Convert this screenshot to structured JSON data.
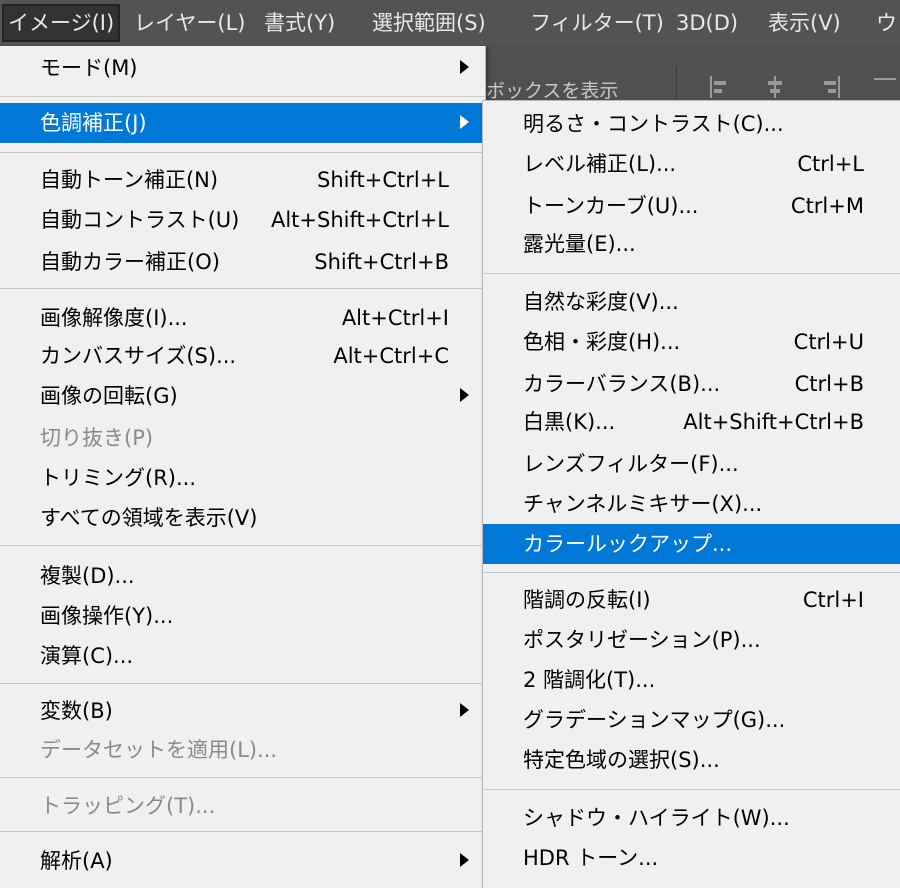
{
  "menubar": {
    "items": [
      {
        "label": "イメージ(I)"
      },
      {
        "label": "レイヤー(L)"
      },
      {
        "label": "書式(Y)"
      },
      {
        "label": "選択範囲(S)"
      },
      {
        "label": "フィルター(T)"
      },
      {
        "label": "3D(D)"
      },
      {
        "label": "表示(V)"
      },
      {
        "label": "ウ"
      }
    ]
  },
  "options_bar": {
    "text": "ボックスを表示"
  },
  "main_menu": {
    "items": [
      {
        "label": "モード(M)",
        "shortcut": ""
      },
      {
        "label": "色調補正(J)",
        "shortcut": ""
      },
      {
        "label": "自動トーン補正(N)",
        "shortcut": "Shift+Ctrl+L"
      },
      {
        "label": "自動コントラスト(U)",
        "shortcut": "Alt+Shift+Ctrl+L"
      },
      {
        "label": "自動カラー補正(O)",
        "shortcut": "Shift+Ctrl+B"
      },
      {
        "label": "画像解像度(I)...",
        "shortcut": "Alt+Ctrl+I"
      },
      {
        "label": "カンバスサイズ(S)...",
        "shortcut": "Alt+Ctrl+C"
      },
      {
        "label": "画像の回転(G)",
        "shortcut": ""
      },
      {
        "label": "切り抜き(P)",
        "shortcut": ""
      },
      {
        "label": "トリミング(R)...",
        "shortcut": ""
      },
      {
        "label": "すべての領域を表示(V)",
        "shortcut": ""
      },
      {
        "label": "複製(D)...",
        "shortcut": ""
      },
      {
        "label": "画像操作(Y)...",
        "shortcut": ""
      },
      {
        "label": "演算(C)...",
        "shortcut": ""
      },
      {
        "label": "変数(B)",
        "shortcut": ""
      },
      {
        "label": "データセットを適用(L)...",
        "shortcut": ""
      },
      {
        "label": "トラッピング(T)...",
        "shortcut": ""
      },
      {
        "label": "解析(A)",
        "shortcut": ""
      }
    ]
  },
  "sub_menu": {
    "items": [
      {
        "label": "明るさ・コントラスト(C)...",
        "shortcut": ""
      },
      {
        "label": "レベル補正(L)...",
        "shortcut": "Ctrl+L"
      },
      {
        "label": "トーンカーブ(U)...",
        "shortcut": "Ctrl+M"
      },
      {
        "label": "露光量(E)...",
        "shortcut": ""
      },
      {
        "label": "自然な彩度(V)...",
        "shortcut": ""
      },
      {
        "label": "色相・彩度(H)...",
        "shortcut": "Ctrl+U"
      },
      {
        "label": "カラーバランス(B)...",
        "shortcut": "Ctrl+B"
      },
      {
        "label": "白黒(K)...",
        "shortcut": "Alt+Shift+Ctrl+B"
      },
      {
        "label": "レンズフィルター(F)...",
        "shortcut": ""
      },
      {
        "label": "チャンネルミキサー(X)...",
        "shortcut": ""
      },
      {
        "label": "カラールックアップ...",
        "shortcut": ""
      },
      {
        "label": "階調の反転(I)",
        "shortcut": "Ctrl+I"
      },
      {
        "label": "ポスタリゼーション(P)...",
        "shortcut": ""
      },
      {
        "label": "2 階調化(T)...",
        "shortcut": ""
      },
      {
        "label": "グラデーションマップ(G)...",
        "shortcut": ""
      },
      {
        "label": "特定色域の選択(S)...",
        "shortcut": ""
      },
      {
        "label": "シャドウ・ハイライト(W)...",
        "shortcut": ""
      },
      {
        "label": "HDR トーン...",
        "shortcut": ""
      }
    ]
  },
  "colors": {
    "highlight": "#0078d7",
    "menu_bg": "#f0f0f0",
    "disabled_text": "#8a8a8a",
    "menubar_bg": "#535353"
  }
}
